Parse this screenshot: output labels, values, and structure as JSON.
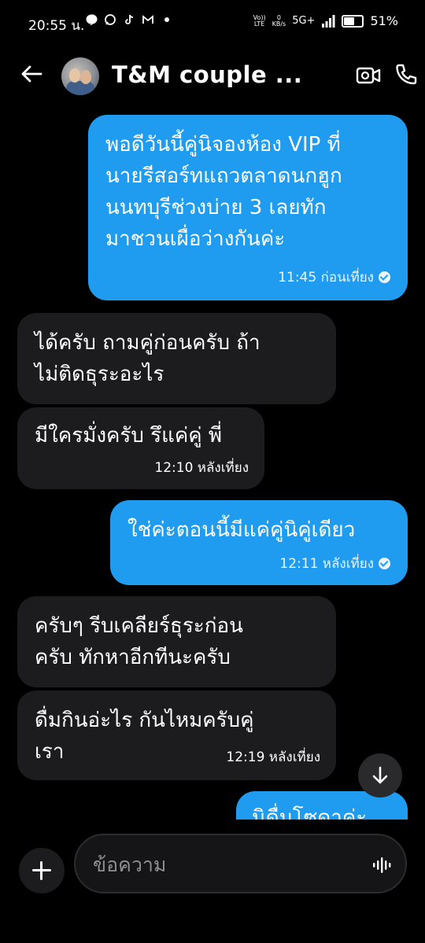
{
  "status_bar": {
    "time": "20:55 น.",
    "volte": "Vo))\nLTE",
    "data_rate": "0\nKB/s",
    "network": "5G+",
    "battery": "51%"
  },
  "header": {
    "title": "T&M couple ..."
  },
  "messages": [
    {
      "side": "out",
      "text": "พอดีวันนี้คู่นิจองห้อง VIP ที่\nนายรีสอร์ทแถวตลาดนกฮูก\nนนทบุรีช่วงบ่าย 3 เลยทัก\nมาชวนเผื่อว่างกันค่ะ",
      "time": "11:45 ก่อนเที่ยง"
    },
    {
      "side": "in",
      "text": "ได้ครับ ถามคู่ก่อนครับ  ถ้า\nไม่ติดธุระอะไร",
      "time": ""
    },
    {
      "side": "in",
      "text": "มีใครมั่งครับ รึแค่คู่ พี่",
      "time": "12:10 หลังเที่ยง"
    },
    {
      "side": "out",
      "text": "ใช่ค่ะตอนนี้มีแค่คู่นิคู่เดียว",
      "time": "12:11 หลังเที่ยง"
    },
    {
      "side": "in",
      "text": "ครับๆ รีบเคลียร์ธุระก่อน\nครับ ทักหาอีกทีนะครับ",
      "time": ""
    },
    {
      "side": "in",
      "text": "ดื่มกินอ่ะไร กันไหมครับคู่\nเรา",
      "time": "12:19 หลังเที่ยง"
    },
    {
      "side": "out",
      "text": "นิดื่มโซดาค่ะ",
      "time": ""
    }
  ],
  "composer": {
    "placeholder": "ข้อความ"
  }
}
